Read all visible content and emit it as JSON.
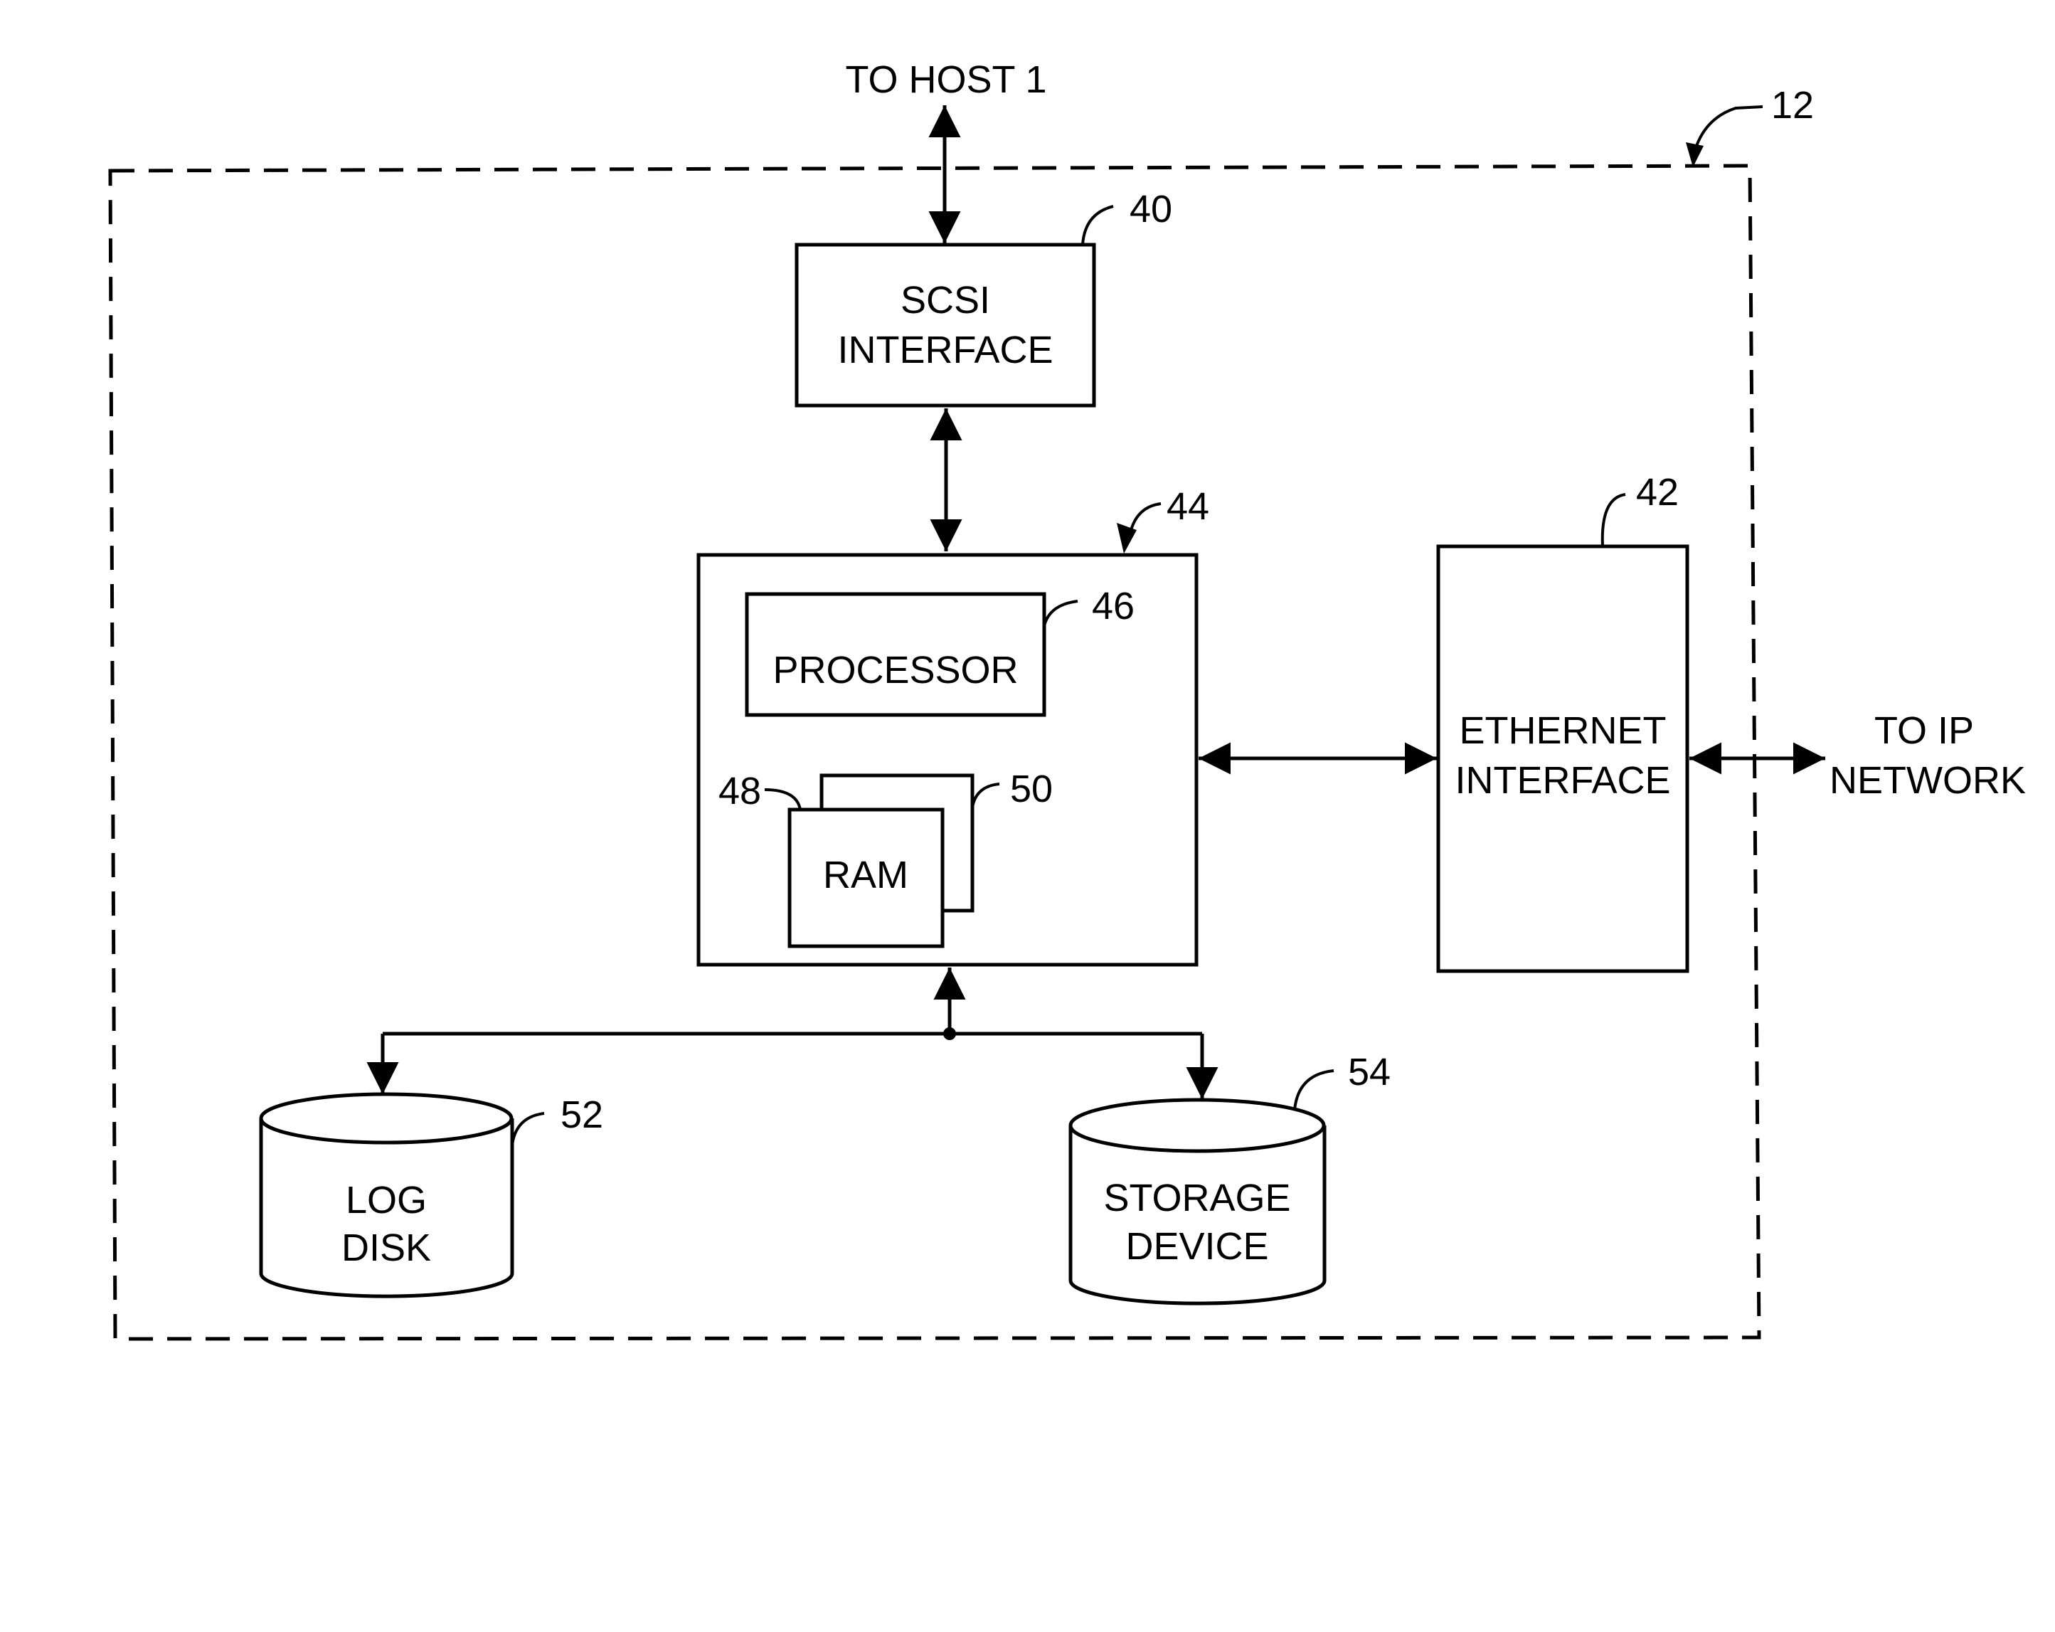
{
  "figure": {
    "enclosure_ref": "12",
    "external": {
      "host": "TO HOST 1",
      "network_line1": "TO IP",
      "network_line2": "NETWORK"
    },
    "blocks": {
      "scsi": {
        "ref": "40",
        "line1": "SCSI",
        "line2": "INTERFACE"
      },
      "controller": {
        "ref": "44"
      },
      "processor": {
        "ref": "46",
        "label": "PROCESSOR"
      },
      "ram": {
        "ref": "48",
        "label": "RAM"
      },
      "ram_back": {
        "ref": "50"
      },
      "ethernet": {
        "ref": "42",
        "line1": "ETHERNET",
        "line2": "INTERFACE"
      },
      "log_disk": {
        "ref": "52",
        "line1": "LOG",
        "line2": "DISK"
      },
      "storage": {
        "ref": "54",
        "line1": "STORAGE",
        "line2": "DEVICE"
      }
    },
    "colors": {
      "ink": "#000000",
      "paper": "#ffffff"
    }
  }
}
